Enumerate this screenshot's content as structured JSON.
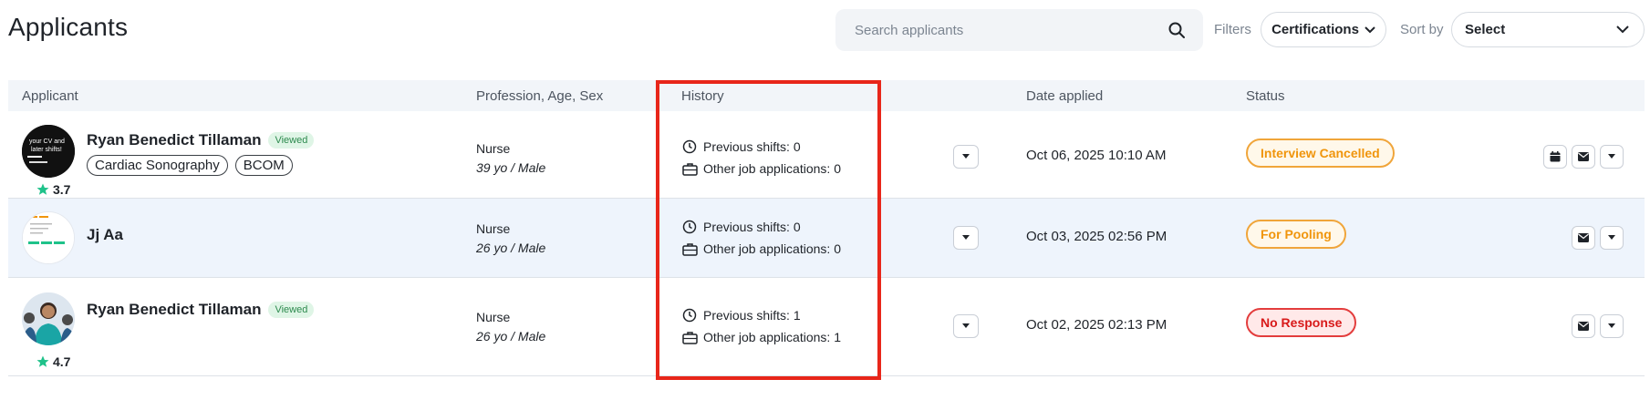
{
  "header": {
    "title": "Applicants",
    "search_placeholder": "Search applicants",
    "filters_label": "Filters",
    "certifications_label": "Certifications",
    "sortby_label": "Sort by",
    "sort_value": "Select"
  },
  "table": {
    "columns": [
      "Applicant",
      "Profession, Age, Sex",
      "History",
      "Date applied",
      "Status"
    ],
    "rows": [
      {
        "name": "Ryan Benedict Tillaman",
        "viewed": "Viewed",
        "tags": [
          "Cardiac Sonography",
          "BCOM"
        ],
        "rating": "3.7",
        "profession": "Nurse",
        "age_sex": "39 yo / Male",
        "prev_shifts": "Previous shifts: 0",
        "other_apps": "Other job applications: 0",
        "date": "Oct 06, 2025 10:10 AM",
        "status": "Interview Cancelled"
      },
      {
        "name": "Jj Aa",
        "profession": "Nurse",
        "age_sex": "26 yo / Male",
        "prev_shifts": "Previous shifts: 0",
        "other_apps": "Other job applications: 0",
        "date": "Oct 03, 2025 02:56 PM",
        "status": "For Pooling"
      },
      {
        "name": "Ryan Benedict Tillaman",
        "viewed": "Viewed",
        "rating": "4.7",
        "profession": "Nurse",
        "age_sex": "26 yo / Male",
        "prev_shifts": "Previous shifts: 1",
        "other_apps": "Other job applications: 1",
        "date": "Oct 02, 2025 02:13 PM",
        "status": "No Response"
      }
    ]
  },
  "colors": {
    "highlight": "#e8261a",
    "status_orange": "#f0950c",
    "status_red": "#d81a1a",
    "rating_star": "#1fc28a",
    "row_highlight": "#eef4fc"
  },
  "icons": [
    "search-icon",
    "chevron-down-icon",
    "clock-icon",
    "briefcase-icon",
    "calendar-icon",
    "mail-icon",
    "caret-down-icon",
    "star-icon"
  ]
}
